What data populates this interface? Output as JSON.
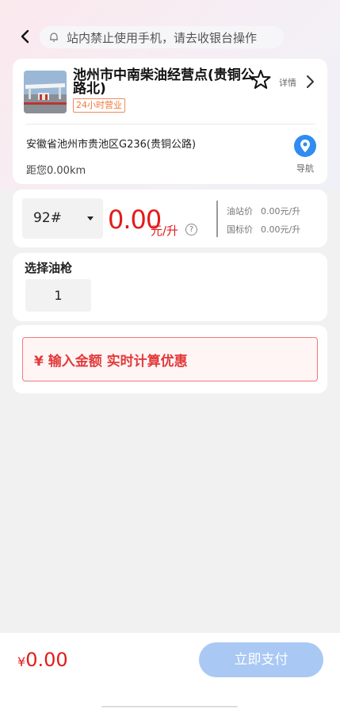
{
  "header": {
    "notice": "站内禁止使用手机，请去收银台操作"
  },
  "station": {
    "name": "池州市中南柴油经营点(贵铜公路北)",
    "hours_badge": "24小时营业",
    "detail_label": "详情",
    "address": "安徽省池州市贵池区G236(贵铜公路)",
    "distance": "距您0.00km",
    "nav_label": "导航"
  },
  "price": {
    "fuel_type": "92#",
    "price_value": "0.00",
    "price_unit": "元/升",
    "station_price_label": "油站价",
    "station_price_value": "0.00元/升",
    "national_price_label": "国标价",
    "national_price_value": "0.00元/升"
  },
  "gun": {
    "title": "选择油枪",
    "selected": "1"
  },
  "amount": {
    "placeholder": "¥ 输入金额 实时计算优惠"
  },
  "footer": {
    "currency": "¥",
    "total": "0.00",
    "pay_label": "立即支付"
  },
  "colors": {
    "price_red": "#e31b1b",
    "pay_button_disabled": "#a9c8f4",
    "nav_blue": "#2f8cf0",
    "badge_orange": "#f0793f"
  }
}
